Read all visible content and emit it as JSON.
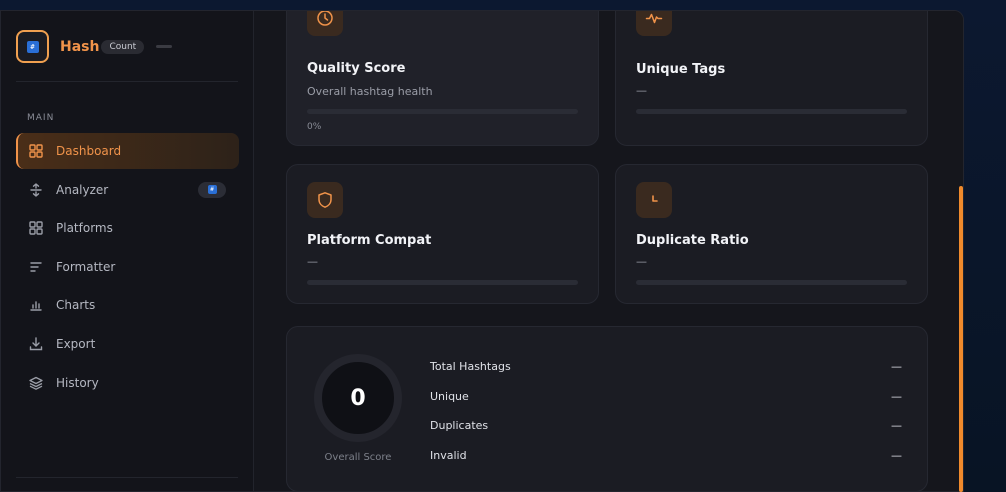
{
  "brand": {
    "name": "Hash",
    "badge": "Count"
  },
  "sidebar": {
    "section_label": "MAIN",
    "items": [
      {
        "label": "Dashboard",
        "icon": "grid-icon",
        "active": true
      },
      {
        "label": "Analyzer",
        "icon": "sort-arrows-icon",
        "active": false
      },
      {
        "label": "Platforms",
        "icon": "grid-icon",
        "active": false
      },
      {
        "label": "Formatter",
        "icon": "lines-icon",
        "active": false
      },
      {
        "label": "Charts",
        "icon": "bar-chart-icon",
        "active": false
      },
      {
        "label": "Export",
        "icon": "download-icon",
        "active": false
      },
      {
        "label": "History",
        "icon": "layers-icon",
        "active": false
      }
    ]
  },
  "cards": {
    "quality": {
      "title": "Quality Score",
      "subtitle": "Overall hashtag health",
      "percent_label": "0%",
      "progress": 0,
      "icon": "clock-icon"
    },
    "unique_tags": {
      "title": "Unique Tags",
      "value": "—",
      "progress": 0,
      "icon": "pulse-icon"
    },
    "platform_compat": {
      "title": "Platform Compat",
      "value": "—",
      "progress": 0,
      "icon": "shield-icon"
    },
    "duplicate_ratio": {
      "title": "Duplicate Ratio",
      "value": "—",
      "progress": 0,
      "icon": "pie-icon"
    }
  },
  "summary": {
    "score": "0",
    "score_label": "Overall Score",
    "stats": [
      {
        "label": "Total Hashtags",
        "value": "—"
      },
      {
        "label": "Unique",
        "value": "—"
      },
      {
        "label": "Duplicates",
        "value": "—"
      },
      {
        "label": "Invalid",
        "value": "—"
      }
    ]
  },
  "colors": {
    "accent": "#f0934a",
    "background": "#15161c",
    "card": "#1b1c23"
  }
}
